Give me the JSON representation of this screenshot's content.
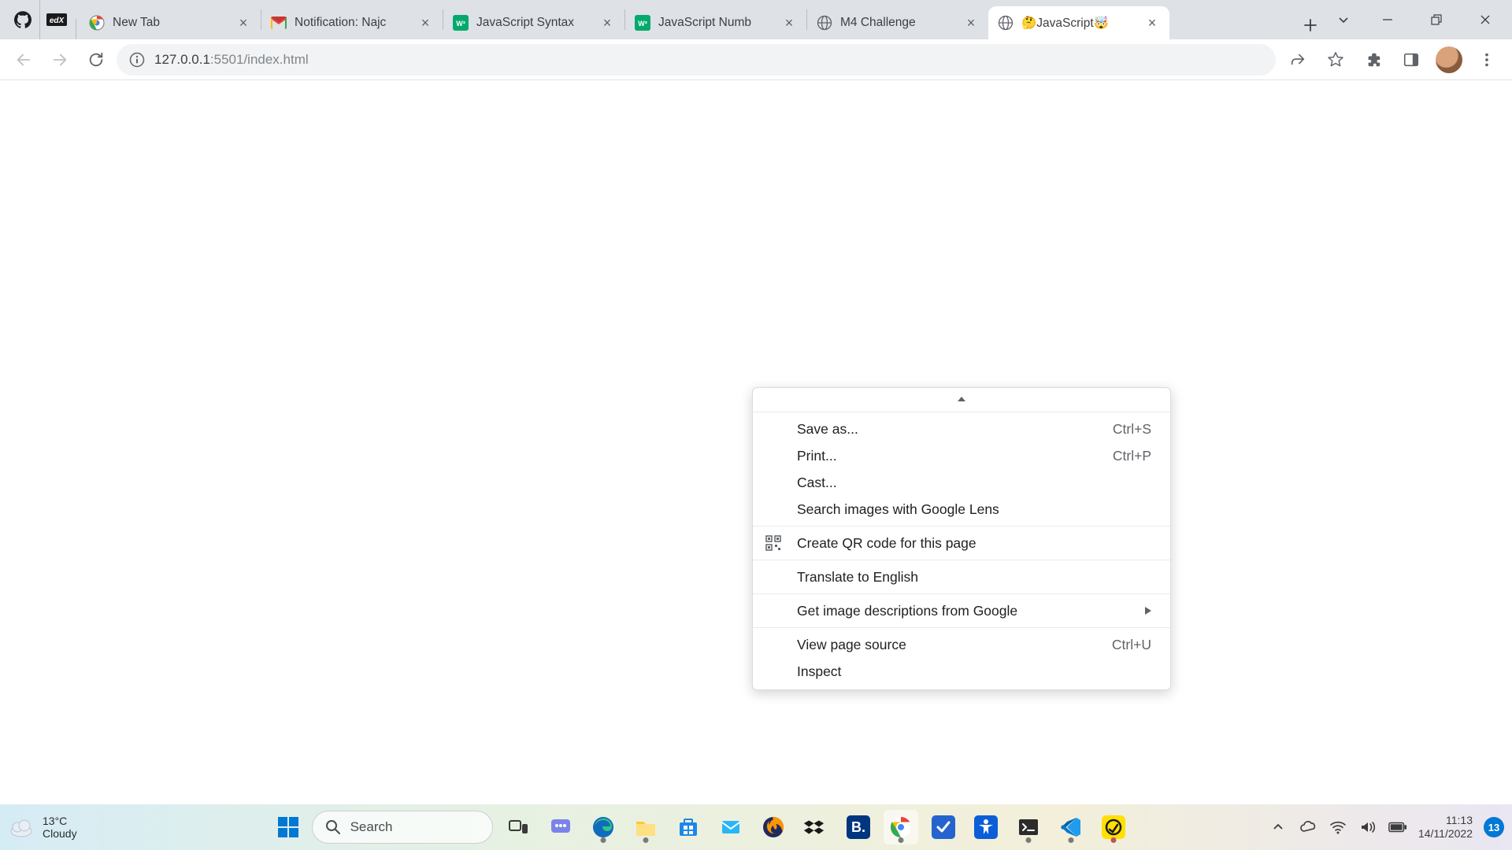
{
  "tabs": {
    "pinned": [
      {
        "icon": "github"
      },
      {
        "icon": "edx"
      }
    ],
    "list": [
      {
        "title": "New Tab",
        "favicon": "chrome"
      },
      {
        "title": "Notification: Najc",
        "favicon": "gmail"
      },
      {
        "title": "JavaScript Syntax",
        "favicon": "w3"
      },
      {
        "title": "JavaScript Numb",
        "favicon": "w3"
      },
      {
        "title": "M4 Challenge",
        "favicon": "globe"
      },
      {
        "title": "🤔JavaScript🤯",
        "favicon": "globe",
        "active": true
      }
    ],
    "new_tab_label": "+"
  },
  "address_bar": {
    "url_host": "127.0.0.1",
    "url_port_path": ":5501/index.html"
  },
  "context_menu": {
    "items": [
      {
        "label": "Save as...",
        "accel": "Ctrl+S"
      },
      {
        "label": "Print...",
        "accel": "Ctrl+P"
      },
      {
        "label": "Cast..."
      },
      {
        "label": "Search images with Google Lens"
      }
    ],
    "qr_label": "Create QR code for this page",
    "translate_label": "Translate to English",
    "image_desc_label": "Get image descriptions from Google",
    "view_source": {
      "label": "View page source",
      "accel": "Ctrl+U"
    },
    "inspect_label": "Inspect"
  },
  "taskbar": {
    "weather": {
      "temp": "13°C",
      "desc": "Cloudy"
    },
    "search_placeholder": "Search",
    "time": "11:13",
    "date": "14/11/2022",
    "notif_count": "13"
  }
}
